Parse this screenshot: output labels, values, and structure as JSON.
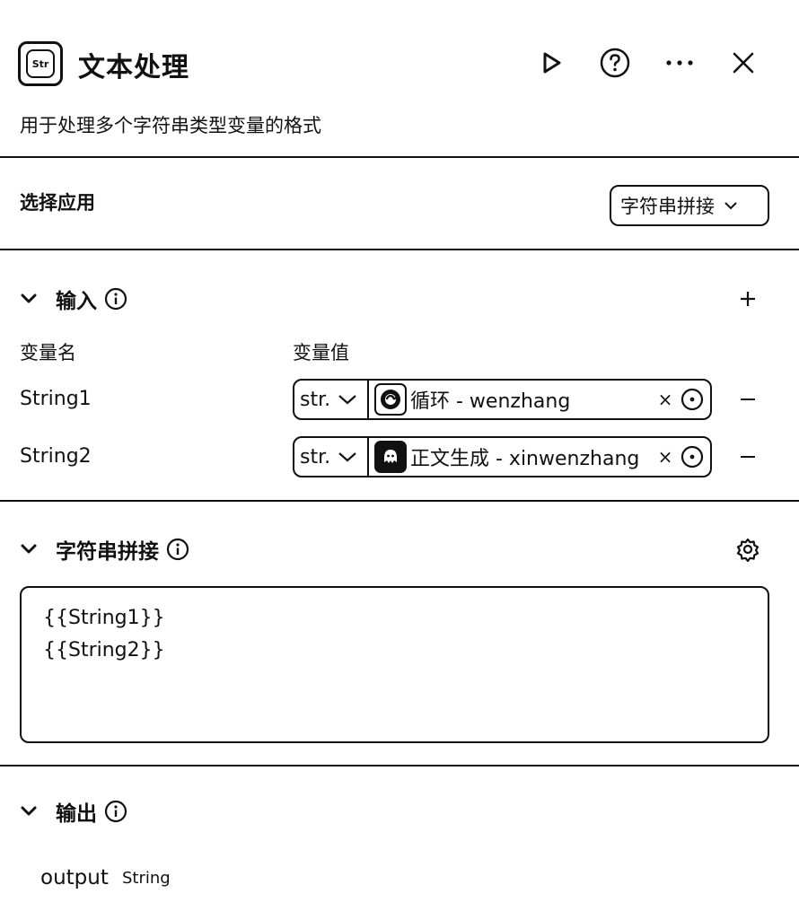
{
  "header": {
    "app_icon_label": "Str",
    "title": "文本处理",
    "description": "用于处理多个字符串类型变量的格式"
  },
  "select_app": {
    "label": "选择应用",
    "value": "字符串拼接"
  },
  "input": {
    "title": "输入",
    "col_name": "变量名",
    "col_value": "变量值",
    "rows": [
      {
        "name": "String1",
        "type": "str.",
        "ref": "循环 - wenzhang",
        "clear": "×",
        "icon": "loop-node-icon"
      },
      {
        "name": "String2",
        "type": "str.",
        "ref": "正文生成 - xinwenzhang",
        "clear": "×",
        "icon": "llm-node-icon"
      }
    ]
  },
  "concat": {
    "title": "字符串拼接",
    "template": "{{String1}}\n{{String2}}"
  },
  "output": {
    "title": "输出",
    "name": "output",
    "type": "String"
  }
}
